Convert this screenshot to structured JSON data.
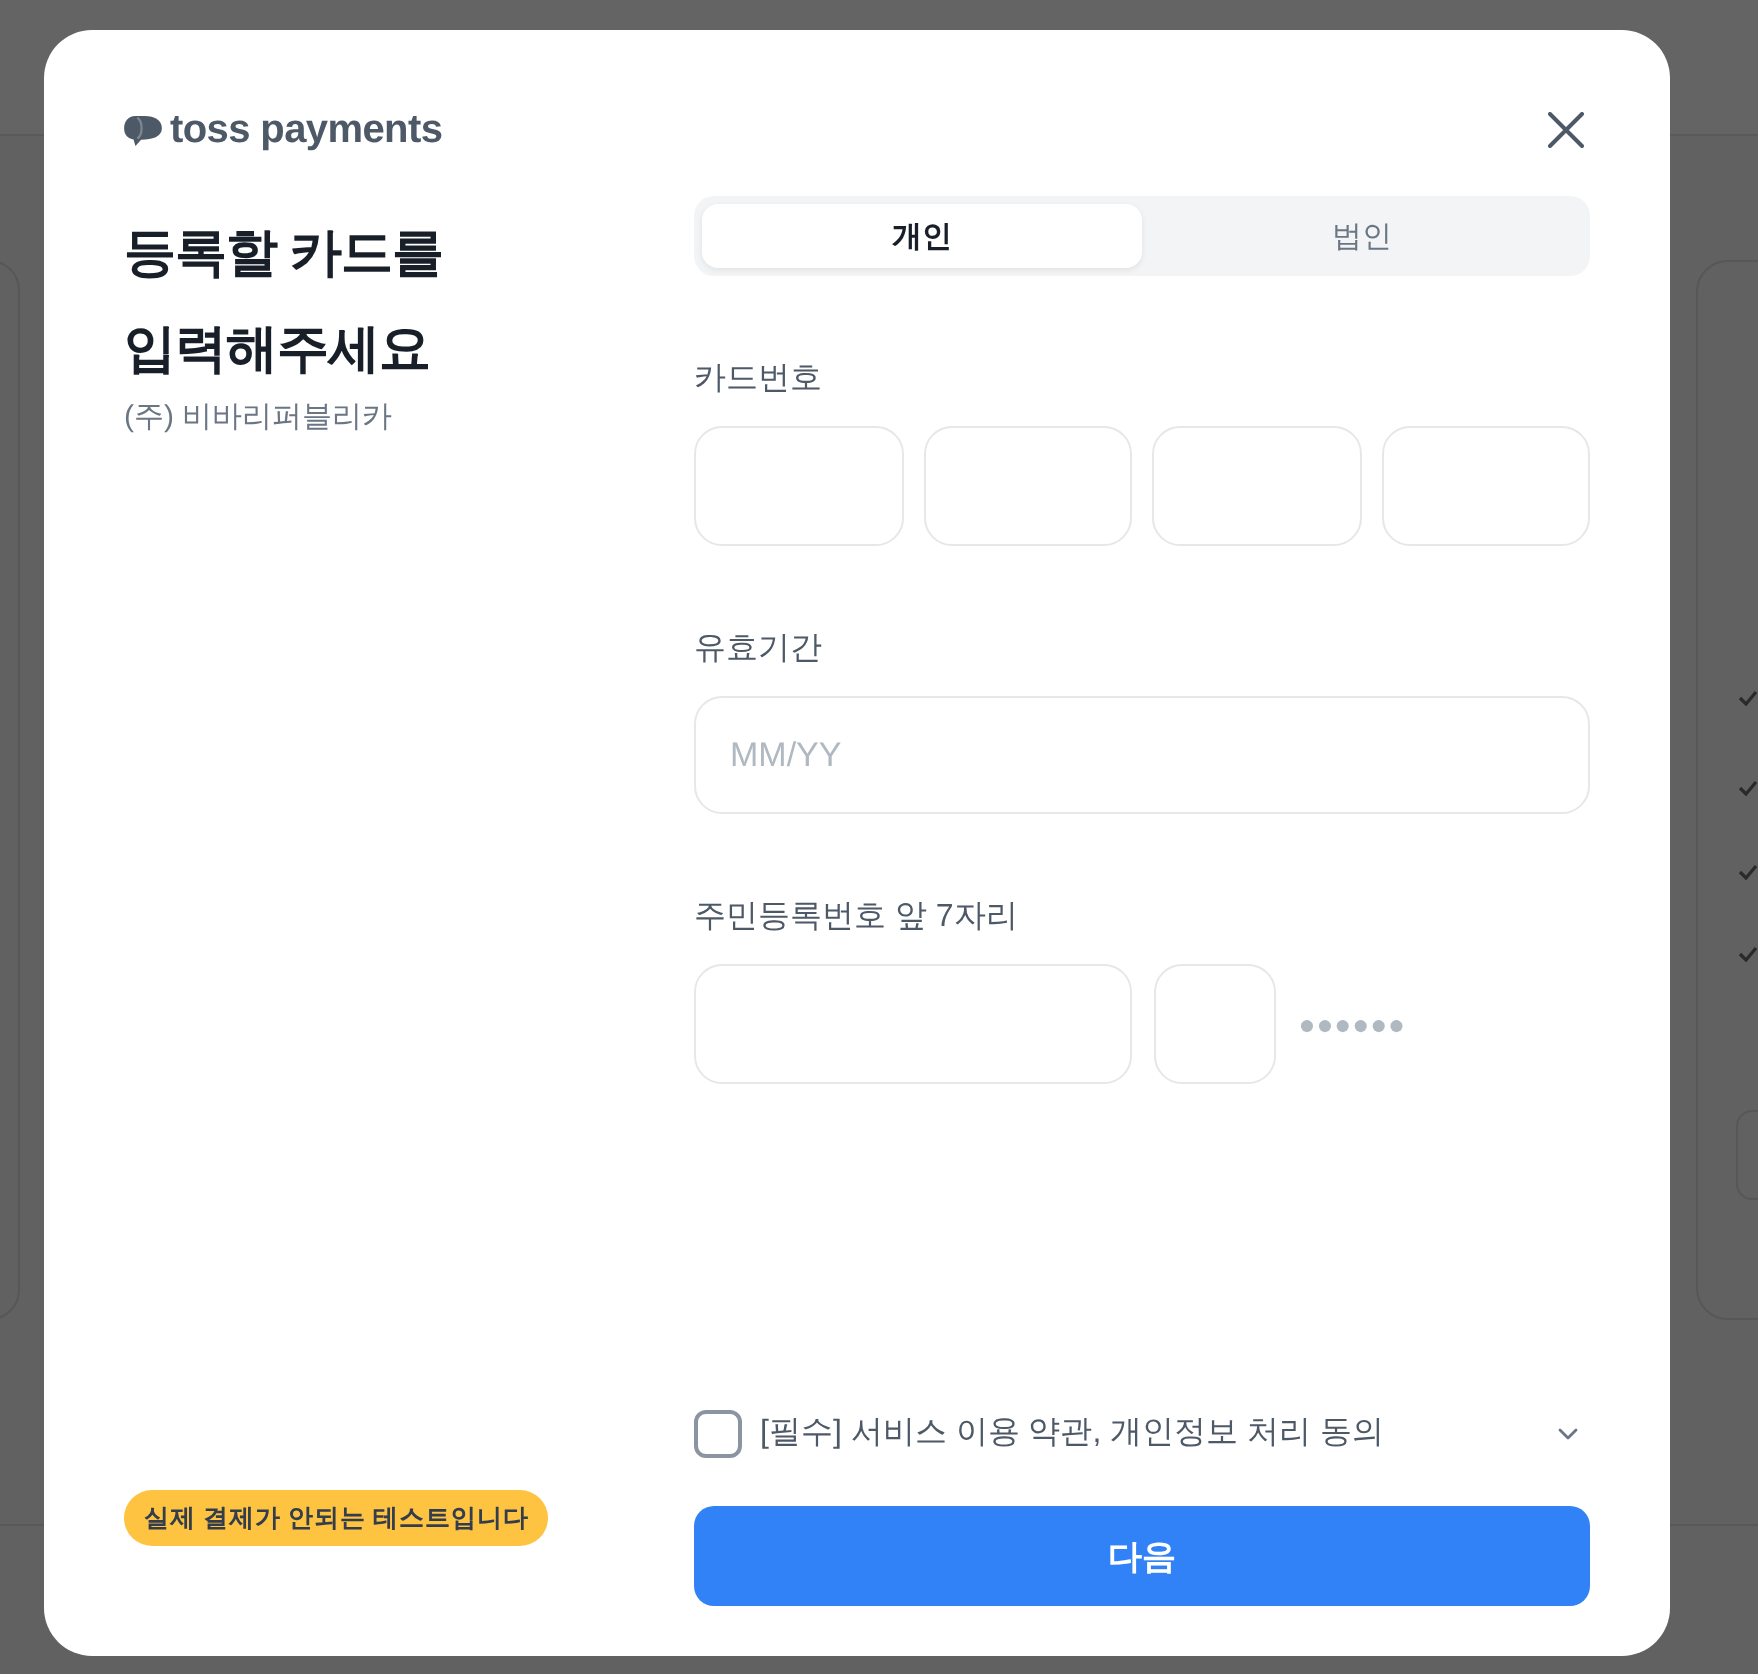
{
  "brand": {
    "name": "toss payments"
  },
  "heading": {
    "lines": [
      "등록할 카드를",
      "입력해주세요"
    ],
    "merchant": "(주) 비바리퍼블리카"
  },
  "test_badge": "실제 결제가 안되는 테스트입니다",
  "tabs": [
    {
      "label": "개인",
      "selected": true
    },
    {
      "label": "법인",
      "selected": false
    }
  ],
  "fields": [
    {
      "label": "카드번호",
      "kind": "segments",
      "inputs": [
        {
          "kind": "text"
        },
        {
          "kind": "text"
        },
        {
          "kind": "text"
        },
        {
          "kind": "text"
        }
      ]
    },
    {
      "label": "유효기간",
      "kind": "single",
      "inputs": [
        {
          "kind": "text",
          "placeholder": "MM/YY"
        }
      ]
    },
    {
      "label": "주민등록번호 앞 7자리",
      "kind": "split",
      "inputs": [
        {
          "kind": "text"
        },
        {
          "kind": "digit"
        }
      ],
      "mask": "●●●●●●"
    }
  ],
  "agreement": {
    "label": "[필수] 서비스 이용 약관, 개인정보 처리 동의",
    "checked": false,
    "expanded": false
  },
  "next_button": "다음"
}
